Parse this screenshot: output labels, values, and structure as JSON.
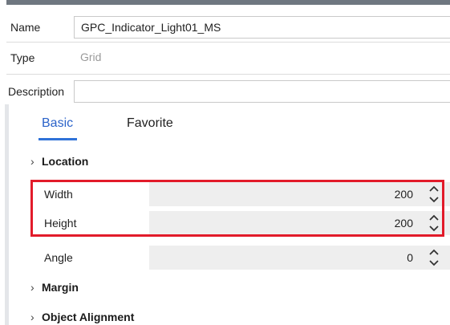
{
  "fields": {
    "name_label": "Name",
    "name_value": "GPC_Indicator_Light01_MS",
    "type_label": "Type",
    "type_value": "Grid",
    "description_label": "Description",
    "description_value": ""
  },
  "tabs": {
    "basic": "Basic",
    "favorite": "Favorite",
    "active": "Basic"
  },
  "sections": {
    "location": "Location",
    "margin": "Margin",
    "object_alignment": "Object Alignment"
  },
  "properties": {
    "width": {
      "label": "Width",
      "value": "200"
    },
    "height": {
      "label": "Height",
      "value": "200"
    },
    "angle": {
      "label": "Angle",
      "value": "0"
    }
  },
  "colors": {
    "accent": "#2f72d8",
    "highlight": "#e21b2a",
    "input_bg": "#eeeeee"
  }
}
